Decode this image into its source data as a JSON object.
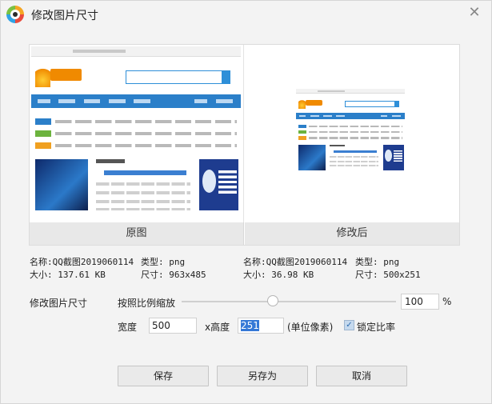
{
  "window": {
    "title": "修改图片尺寸",
    "icon": "app-eye-logo-icon",
    "close_icon": "close-icon"
  },
  "preview": {
    "before_label": "原图",
    "after_label": "修改后"
  },
  "original": {
    "name_label": "名称:",
    "name_value": "QQ截图2019060114",
    "type_label": "类型:",
    "type_value": "png",
    "size_label": "大小:",
    "size_value": "137.61 KB",
    "dim_label": "尺寸:",
    "dim_value": "963x485"
  },
  "modified": {
    "name_label": "名称:",
    "name_value": "QQ截图2019060114",
    "type_label": "类型:",
    "type_value": "png",
    "size_label": "大小:",
    "size_value": "36.98 KB",
    "dim_label": "尺寸:",
    "dim_value": "500x251"
  },
  "resize": {
    "section_label": "修改图片尺寸",
    "scale_label": "按照比例缩放",
    "scale_value": "100",
    "scale_unit": "%",
    "width_label": "宽度",
    "width_value": "500",
    "height_label": "x高度",
    "height_value": "251",
    "unit_label": "(单位像素)",
    "lock_label": "锁定比率",
    "lock_checked": true
  },
  "buttons": {
    "save": "保存",
    "save_as": "另存为",
    "cancel": "取消"
  }
}
